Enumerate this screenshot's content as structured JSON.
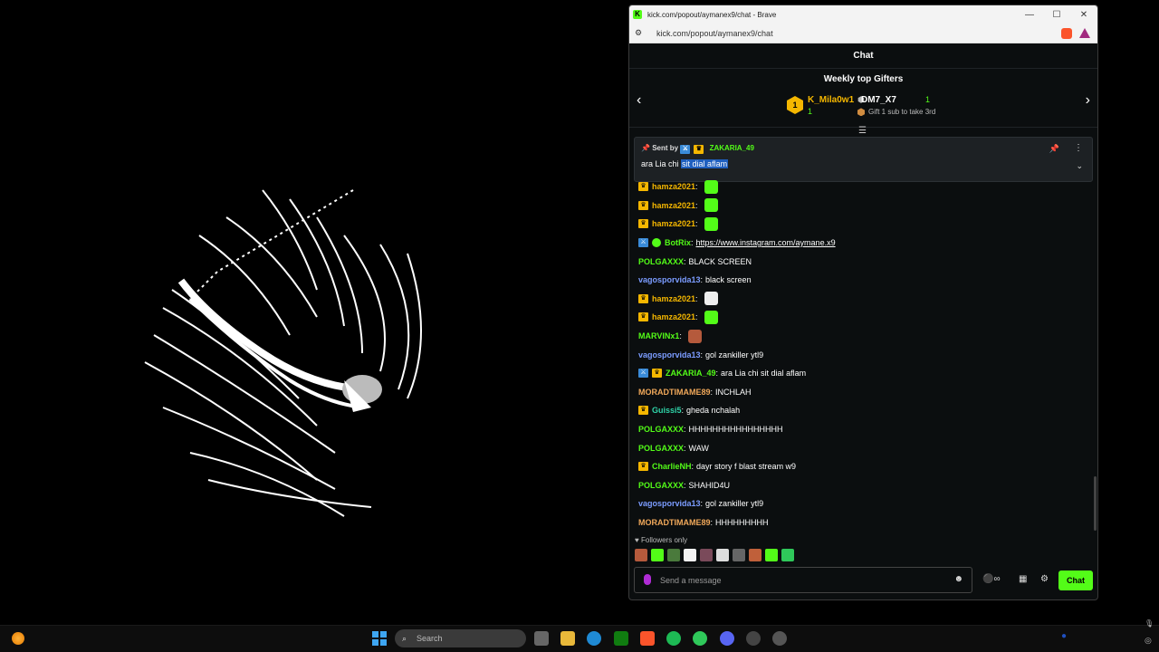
{
  "browser": {
    "title": "kick.com/popout/aymanex9/chat - Brave",
    "url": "kick.com/popout/aymanex9/chat"
  },
  "chat": {
    "header": "Chat",
    "gifters": {
      "title": "Weekly top Gifters",
      "first": {
        "name": "K_Mila0w1",
        "count": "1",
        "rank": "1"
      },
      "second": {
        "name": "DM7_X7",
        "count": "1"
      },
      "third_hint": "Gift 1 sub to take 3rd"
    },
    "pinned": {
      "sent_by": "Sent by",
      "username": "ZAKARIA_49",
      "message_prefix": "ara Lia chi",
      "message_highlight": "sit dial aflam"
    },
    "messages": [
      {
        "user": "hamza2021",
        "color": "#f5b700",
        "badges": [
          "crown"
        ],
        "text": "",
        "emote": "#53fc18"
      },
      {
        "user": "hamza2021",
        "color": "#f5b700",
        "badges": [
          "crown"
        ],
        "text": "",
        "emote": "#53fc18"
      },
      {
        "user": "hamza2021",
        "color": "#f5b700",
        "badges": [
          "crown"
        ],
        "text": "",
        "emote": "#53fc18"
      },
      {
        "user": "BotRix",
        "color": "#53fc18",
        "badges": [
          "mod",
          "verified"
        ],
        "text": "https://www.instagram.com/aymane.x9",
        "link": true
      },
      {
        "user": "POLGAXXX",
        "color": "#53fc18",
        "badges": [],
        "text": "BLACK SCREEN"
      },
      {
        "user": "vagosporvida13",
        "color": "#7b9cff",
        "badges": [],
        "text": "black screen"
      },
      {
        "user": "hamza2021",
        "color": "#f5b700",
        "badges": [
          "crown"
        ],
        "text": "",
        "emote": "#eeeeee"
      },
      {
        "user": "hamza2021",
        "color": "#f5b700",
        "badges": [
          "crown"
        ],
        "text": "",
        "emote": "#53fc18"
      },
      {
        "user": "MARVINx1",
        "color": "#53fc18",
        "badges": [],
        "text": "",
        "emote": "#b55a3c"
      },
      {
        "user": "vagosporvida13",
        "color": "#7b9cff",
        "badges": [],
        "text": "gol zankiller ytl9"
      },
      {
        "user": "ZAKARIA_49",
        "color": "#53fc18",
        "badges": [
          "mod",
          "crown"
        ],
        "text": "ara Lia chi sit dial aflam"
      },
      {
        "user": "MORADTIMAME89",
        "color": "#f0a85a",
        "badges": [],
        "text": "INCHLAH"
      },
      {
        "user": "Guissi5",
        "color": "#2fd3a8",
        "badges": [
          "crown"
        ],
        "text": "gheda nchalah"
      },
      {
        "user": "POLGAXXX",
        "color": "#53fc18",
        "badges": [],
        "text": "HHHHHHHHHHHHHHHH"
      },
      {
        "user": "POLGAXXX",
        "color": "#53fc18",
        "badges": [],
        "text": "WAW"
      },
      {
        "user": "CharlieNH",
        "color": "#53fc18",
        "badges": [
          "crown"
        ],
        "text": "dayr story f blast stream w9"
      },
      {
        "user": "POLGAXXX",
        "color": "#53fc18",
        "badges": [],
        "text": "SHAHID4U"
      },
      {
        "user": "vagosporvida13",
        "color": "#7b9cff",
        "badges": [],
        "text": "gol zankiller ytl9"
      },
      {
        "user": "MORADTIMAME89",
        "color": "#f0a85a",
        "badges": [],
        "text": "HHHHHHHHH"
      }
    ],
    "followers_only": "Followers only",
    "composer": {
      "placeholder": "Send a message",
      "send_label": "Chat"
    }
  },
  "taskbar": {
    "search_placeholder": "Search"
  },
  "colors": {
    "accent": "#53fc18",
    "gold": "#f5b700"
  }
}
